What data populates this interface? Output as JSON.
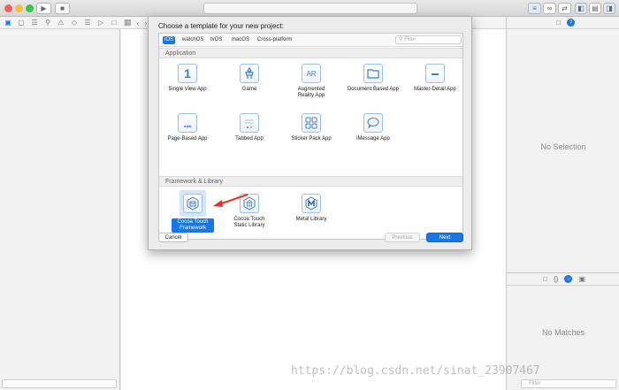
{
  "sheet": {
    "title": "Choose a template for your new project:",
    "platform_tabs": [
      "iOS",
      "watchOS",
      "tvOS",
      "macOS",
      "Cross-platform"
    ],
    "selected_platform": "iOS",
    "filter_placeholder": "Filter",
    "sections": {
      "application": "Application",
      "framework": "Framework & Library"
    },
    "application_templates": [
      {
        "label": "Single View App",
        "icon": "single-view-icon",
        "glyph": "1"
      },
      {
        "label": "Game",
        "icon": "game-icon",
        "glyph": ""
      },
      {
        "label": "Augmented Reality App",
        "icon": "ar-icon",
        "glyph": "AR"
      },
      {
        "label": "Document Based App",
        "icon": "document-icon",
        "glyph": ""
      },
      {
        "label": "Master-Detail App",
        "icon": "master-detail-icon",
        "glyph": ""
      },
      {
        "label": "Page-Based App",
        "icon": "page-based-icon",
        "glyph": ""
      },
      {
        "label": "Tabbed App",
        "icon": "tabbed-icon",
        "glyph": ""
      },
      {
        "label": "Sticker Pack App",
        "icon": "sticker-pack-icon",
        "glyph": ""
      },
      {
        "label": "iMessage App",
        "icon": "imessage-icon",
        "glyph": ""
      }
    ],
    "framework_templates": [
      {
        "label": "Cocoa Touch Framework",
        "icon": "cocoa-touch-framework-icon",
        "selected": true
      },
      {
        "label": "Cocoa Touch Static Library",
        "icon": "static-library-icon",
        "selected": false
      },
      {
        "label": "Metal Library",
        "icon": "metal-library-icon",
        "selected": false
      }
    ],
    "buttons": {
      "cancel": "Cancel",
      "previous": "Previous",
      "next": "Next"
    }
  },
  "inspector": {
    "no_selection": "No Selection",
    "no_matches": "No Matches",
    "library_filter_placeholder": "Filter"
  },
  "watermark": "https://blog.csdn.net/sinat_23907467",
  "colors": {
    "accent": "#1877e6",
    "arrow": "#e0342a",
    "close": "#fc605c",
    "minimize": "#fdbc40",
    "zoom": "#34c84a"
  }
}
